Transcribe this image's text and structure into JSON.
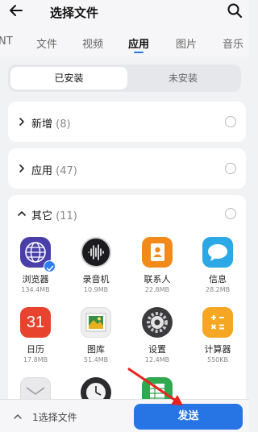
{
  "header": {
    "title": "选择文件"
  },
  "tabs": [
    "NT",
    "文件",
    "视频",
    "应用",
    "图片",
    "音乐"
  ],
  "segment": {
    "installed": "已安装",
    "not_installed": "未安装"
  },
  "groups": [
    {
      "name": "新增",
      "count": "(8)",
      "expanded": false
    },
    {
      "name": "应用",
      "count": "(47)",
      "expanded": false
    },
    {
      "name": "其它",
      "count": "(11)",
      "expanded": true
    }
  ],
  "apps": [
    {
      "name": "浏览器",
      "size": "134.4MB",
      "icon": "browser-icon",
      "selected": true
    },
    {
      "name": "录音机",
      "size": "10.9MB",
      "icon": "recorder-icon",
      "selected": false
    },
    {
      "name": "联系人",
      "size": "22.8MB",
      "icon": "contacts-icon",
      "selected": false
    },
    {
      "name": "信息",
      "size": "28.2MB",
      "icon": "messages-icon",
      "selected": false
    },
    {
      "name": "日历",
      "size": "17.8MB",
      "icon": "calendar-icon",
      "calendar_day": "31",
      "selected": false
    },
    {
      "name": "图库",
      "size": "51.4MB",
      "icon": "gallery-icon",
      "selected": false
    },
    {
      "name": "设置",
      "size": "12.4MB",
      "icon": "settings-icon",
      "selected": false
    },
    {
      "name": "计算器",
      "size": "550KB",
      "icon": "calculator-icon",
      "selected": false
    }
  ],
  "bottom": {
    "selected_text": "1选择文件",
    "send_label": "发送"
  },
  "colors": {
    "accent": "#2775e5",
    "arrow": "#e8231f"
  }
}
